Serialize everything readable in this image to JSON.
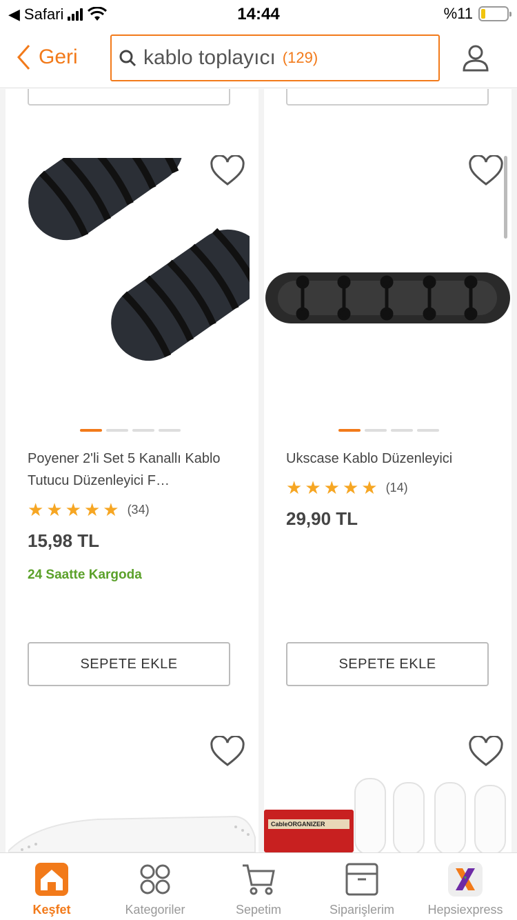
{
  "status": {
    "back_app": "Safari",
    "time": "14:44",
    "battery": "%11"
  },
  "nav": {
    "back_label": "Geri",
    "search_query": "kablo toplayıcı",
    "result_count": "(129)"
  },
  "products": [
    {
      "name": "Poyener 2'li Set 5 Kanallı Kablo Tutucu Düzenleyici F…",
      "rating": 5,
      "reviews": "(34)",
      "price": "15,98 TL",
      "cargo": "24 Saatte Kargoda",
      "add_label": "SEPETE EKLE"
    },
    {
      "name": "Ukscase Kablo Düzenleyici",
      "rating": 5,
      "reviews": "(14)",
      "price": "29,90 TL",
      "cargo": "",
      "add_label": "SEPETE EKLE"
    }
  ],
  "promo_label": "CableORGANIZER",
  "tabs": [
    {
      "label": "Keşfet",
      "icon": "home-icon",
      "active": true
    },
    {
      "label": "Kategoriler",
      "icon": "categories-icon",
      "active": false
    },
    {
      "label": "Sepetim",
      "icon": "cart-icon",
      "active": false
    },
    {
      "label": "Siparişlerim",
      "icon": "box-icon",
      "active": false
    },
    {
      "label": "Hepsiexpress",
      "icon": "hepsiexpress-icon",
      "active": false
    }
  ],
  "colors": {
    "accent": "#f27a1a",
    "green": "#5ba12a",
    "star": "#f6a623"
  }
}
